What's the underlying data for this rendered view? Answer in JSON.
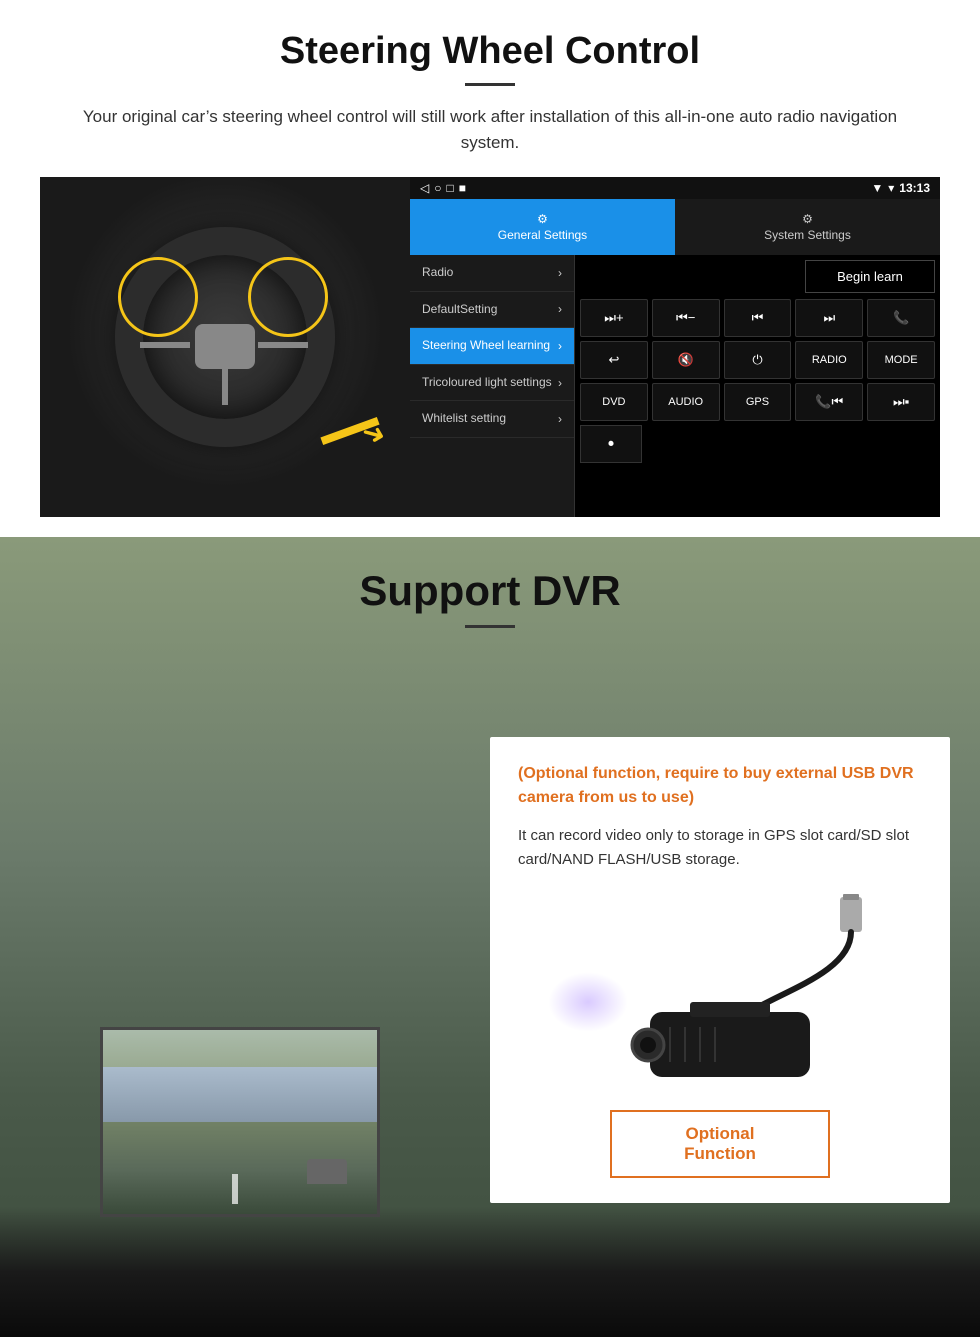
{
  "steering": {
    "title": "Steering Wheel Control",
    "subtitle": "Your original car’s steering wheel control will still work after installation of this all-in-one auto radio navigation system.",
    "statusbar": {
      "time": "13:13",
      "signal_icon": "▼",
      "wifi_icon": "▾"
    },
    "navbar": {
      "back": "◁",
      "home": "○",
      "recent": "□",
      "menu": "■"
    },
    "tabs": {
      "general": "General Settings",
      "system": "System Settings"
    },
    "menu_items": [
      {
        "label": "Radio"
      },
      {
        "label": "DefaultSetting"
      },
      {
        "label": "Steering Wheel learning",
        "active": true
      },
      {
        "label": "Tricoloured light settings"
      },
      {
        "label": "Whitelist setting"
      }
    ],
    "begin_learn_label": "Begin learn",
    "controls": {
      "row1": [
        "❙+",
        "❙−",
        "⏮",
        "⏭",
        "☎"
      ],
      "row2": [
        "↩",
        "🔇×",
        "⏻",
        "RADIO",
        "MODE"
      ],
      "row3": [
        "DVD",
        "AUDIO",
        "GPS",
        "☎⏮",
        "▣⏭"
      ],
      "row4": [
        "⎙"
      ]
    }
  },
  "dvr": {
    "title": "Support DVR",
    "optional_text": "(Optional function, require to buy external USB DVR camera from us to use)",
    "description": "It can record video only to storage in GPS slot card/SD slot card/NAND FLASH/USB storage.",
    "optional_button_label": "Optional Function"
  }
}
